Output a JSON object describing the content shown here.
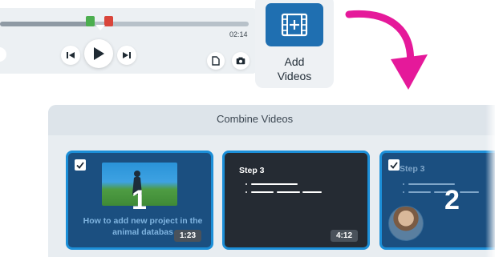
{
  "player": {
    "duration": "02:14",
    "accent_in": "#4cae4f",
    "accent_out": "#d9453b",
    "controls": {
      "prev_icon": "step-back-icon",
      "play_icon": "play-icon",
      "next_icon": "step-forward-icon",
      "document_icon": "document-icon",
      "camera_icon": "camera-icon"
    }
  },
  "add_videos": {
    "label": "Add\nVideos",
    "icon": "film-add-icon",
    "color": "#1f6fb1"
  },
  "combine_panel": {
    "title": "Combine Videos",
    "clips": [
      {
        "number": "1",
        "caption": "How to add new project in the animal databas",
        "duration": "1:23",
        "checked": true
      },
      {
        "step": "Step 3",
        "duration": "4:12",
        "checked": false
      },
      {
        "number": "2",
        "step": "Step 3",
        "checked": true
      }
    ]
  },
  "arrow_color": "#e5199a"
}
